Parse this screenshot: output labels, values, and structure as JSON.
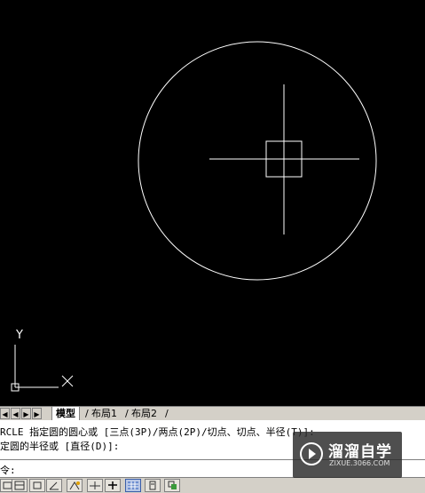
{
  "axes": {
    "y_label": "Y"
  },
  "tabs": {
    "nav": [
      "◀",
      "◀",
      "▶",
      "▶"
    ],
    "items": [
      {
        "label": "模型",
        "active": true
      },
      {
        "label": "布局1",
        "active": false
      },
      {
        "label": "布局2",
        "active": false
      }
    ]
  },
  "command": {
    "line1": "RCLE 指定圆的圆心或 [三点(3P)/两点(2P)/切点、切点、半径(T)]:",
    "line2": "定圆的半径或 [直径(D)]:",
    "prompt": "令:"
  },
  "status_buttons": [
    {
      "icon": "snap-icon",
      "on": false
    },
    {
      "icon": "grid-icon",
      "on": false
    },
    {
      "icon": "ortho-icon",
      "on": false
    },
    {
      "icon": "polar-icon",
      "on": false
    },
    {
      "icon": "osnap-icon",
      "on": false
    },
    {
      "icon": "otrack-icon",
      "on": false
    },
    {
      "icon": "ducs-icon",
      "on": false
    },
    {
      "icon": "dyn-icon",
      "on": true
    },
    {
      "icon": "lineweight-icon",
      "on": false
    },
    {
      "icon": "quick-properties-icon",
      "on": false
    }
  ],
  "watermark": {
    "title": "溜溜自学",
    "url": "ZIXUE.3066.COM"
  },
  "colors": {
    "canvas": "#000000",
    "drawing": "#ffffff",
    "panel": "#d4d0c8"
  }
}
